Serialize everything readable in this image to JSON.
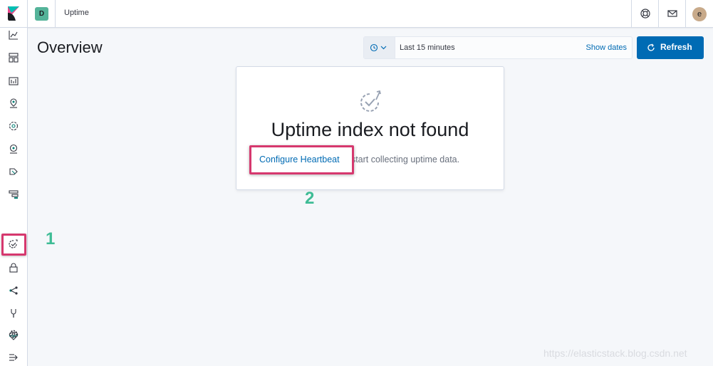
{
  "header": {
    "space_initial": "D",
    "breadcrumb": "Uptime",
    "user_initial": "e",
    "icons": [
      "help-icon",
      "mail-icon"
    ]
  },
  "sidebar": {
    "items": [
      {
        "icon": "visualize-icon"
      },
      {
        "icon": "dashboard-icon"
      },
      {
        "icon": "canvas-icon"
      },
      {
        "icon": "maps-icon"
      },
      {
        "icon": "machine-learning-icon"
      },
      {
        "icon": "infrastructure-icon"
      },
      {
        "icon": "logs-icon"
      },
      {
        "icon": "apm-icon"
      },
      {
        "icon": "uptime-icon",
        "active": true
      },
      {
        "icon": "siem-icon"
      },
      {
        "icon": "graph-icon"
      },
      {
        "icon": "dev-tools-icon"
      },
      {
        "icon": "monitoring-icon"
      },
      {
        "icon": "management-icon"
      }
    ],
    "collapse_icon": "collapse-icon"
  },
  "page": {
    "title": "Overview"
  },
  "datepicker": {
    "range_label": "Last 15 minutes",
    "show_dates": "Show dates",
    "refresh": "Refresh"
  },
  "empty_prompt": {
    "title": "Uptime index not found",
    "link": "Configure Heartbeat",
    "text_after": "to start collecting uptime data."
  },
  "annotations": {
    "one": "1",
    "two": "2"
  },
  "watermark": "https://elasticstack.blog.csdn.net",
  "colors": {
    "accent": "#006bb4",
    "highlight": "#d6386e",
    "annotation": "#3ebc95",
    "space_avatar": "#54b399"
  }
}
